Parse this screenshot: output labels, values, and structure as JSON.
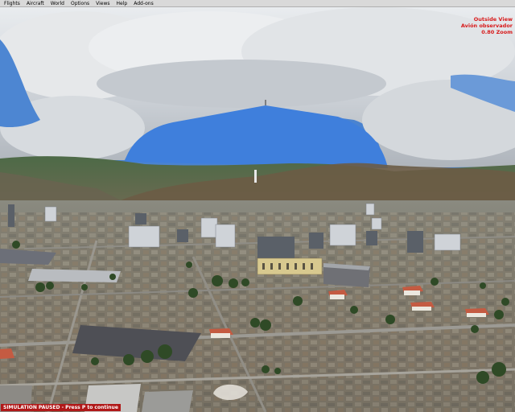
{
  "menu": {
    "items": [
      {
        "label": "Flights"
      },
      {
        "label": "Aircraft"
      },
      {
        "label": "World"
      },
      {
        "label": "Options"
      },
      {
        "label": "Views"
      },
      {
        "label": "Help"
      },
      {
        "label": "Add-ons"
      }
    ]
  },
  "view_info": {
    "view_name": "Outside View",
    "camera": "Avión observador",
    "zoom": "0.80 Zoom"
  },
  "status": {
    "message": "SIMULATION PAUSED - Press P to continue"
  },
  "colors": {
    "menu_bg": "#d9d9d9",
    "overlay_text": "#d81a1a",
    "status_bg": "#b01818"
  }
}
